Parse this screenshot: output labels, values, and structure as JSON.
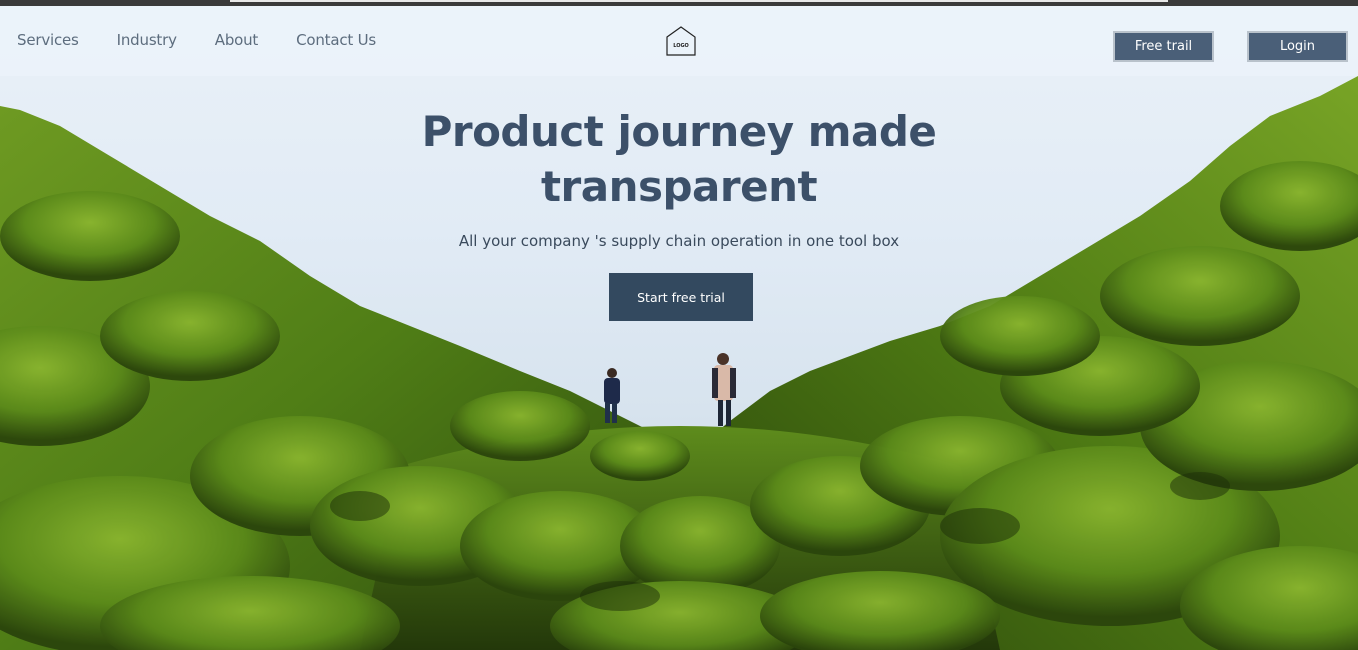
{
  "nav": {
    "links": [
      "Services",
      "Industry",
      "About",
      "Contact Us"
    ],
    "logo_text": "LOGO",
    "free_trail_label": "Free trail",
    "login_label": "Login"
  },
  "hero": {
    "headline_line1": "Product journey made",
    "headline_line2": "transparent",
    "subtitle": "All your company 's supply chain operation in one tool box",
    "cta_label": "Start free trial",
    "background_image": "moss-covered-valley-with-two-hikers"
  },
  "colors": {
    "nav_button_bg": "#4a5f78",
    "cta_bg": "#33495f",
    "headline": "#3c5069",
    "nav_text": "#5d6d7e",
    "moss_green": "#5a8a1a"
  }
}
